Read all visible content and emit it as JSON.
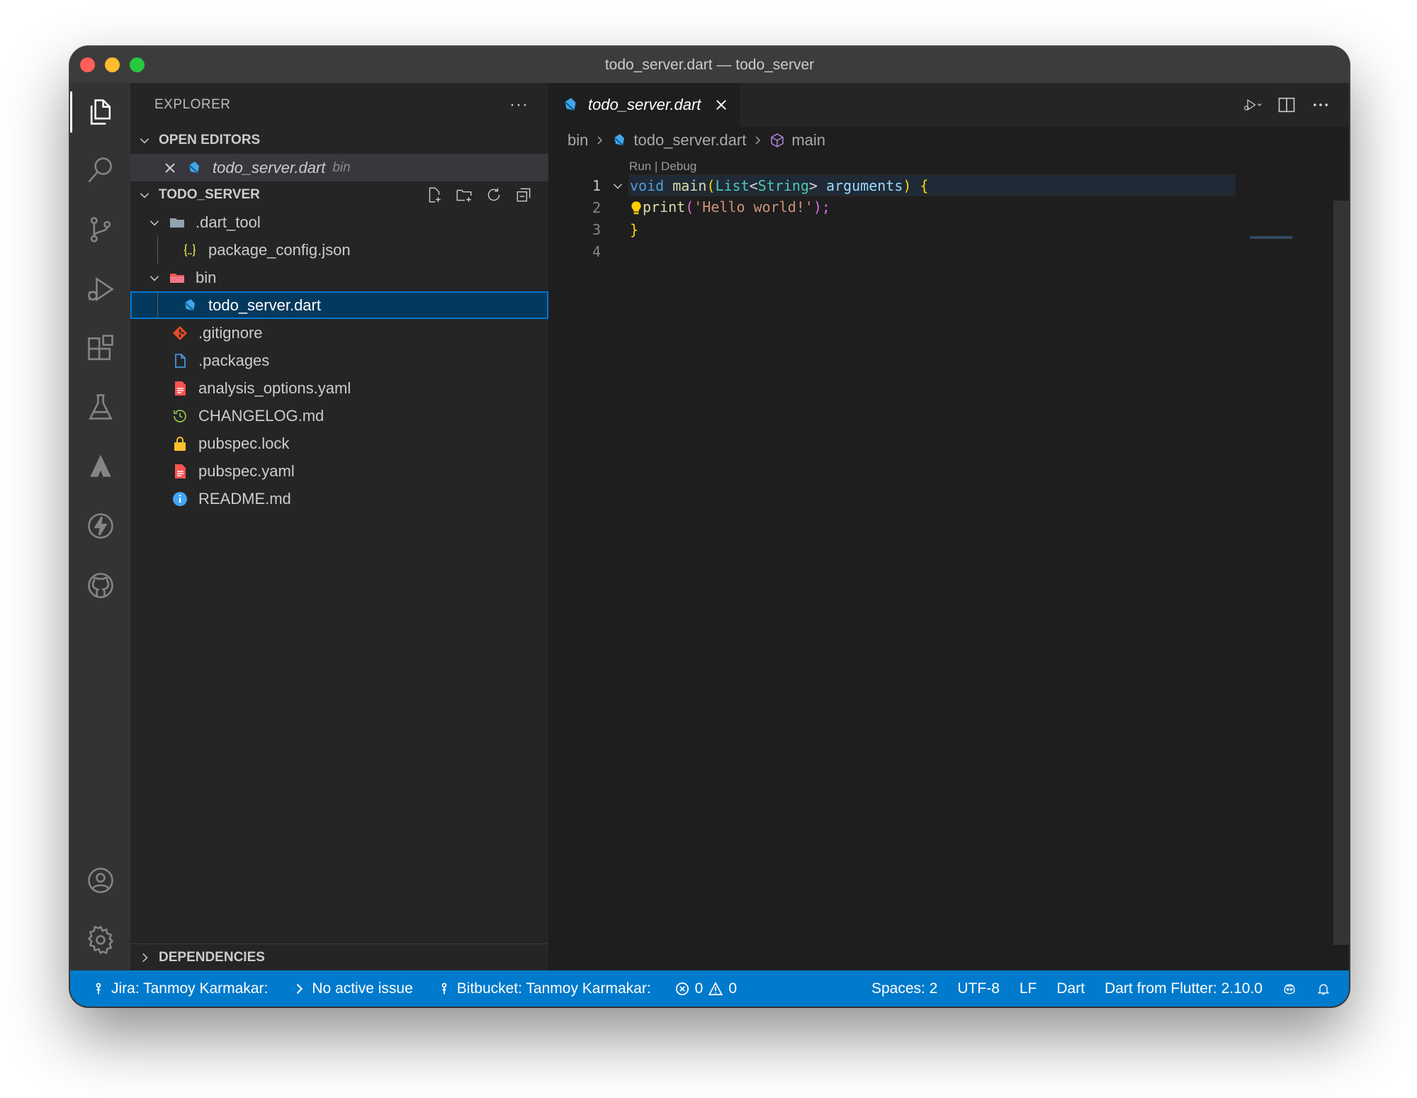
{
  "window": {
    "title": "todo_server.dart — todo_server"
  },
  "sidebar": {
    "title": "EXPLORER",
    "more": "···",
    "open_editors": {
      "label": "OPEN EDITORS",
      "items": [
        {
          "name": "todo_server.dart",
          "dir": "bin"
        }
      ]
    },
    "project": {
      "label": "TODO_SERVER",
      "tree": [
        {
          "label": ".dart_tool",
          "icon": "folder-icon"
        },
        {
          "label": "package_config.json",
          "icon": "json-icon"
        },
        {
          "label": "bin",
          "icon": "folder-bin-icon"
        },
        {
          "label": "todo_server.dart",
          "icon": "dart-icon"
        },
        {
          "label": ".gitignore",
          "icon": "git-icon"
        },
        {
          "label": ".packages",
          "icon": "file-icon"
        },
        {
          "label": "analysis_options.yaml",
          "icon": "yaml-icon"
        },
        {
          "label": "CHANGELOG.md",
          "icon": "changelog-icon"
        },
        {
          "label": "pubspec.lock",
          "icon": "lock-icon"
        },
        {
          "label": "pubspec.yaml",
          "icon": "yaml-icon"
        },
        {
          "label": "README.md",
          "icon": "info-icon"
        }
      ]
    },
    "dependencies_label": "DEPENDENCIES"
  },
  "editor": {
    "tab": {
      "label": "todo_server.dart"
    },
    "breadcrumb": {
      "folder": "bin",
      "file": "todo_server.dart",
      "symbol": "main"
    },
    "codelens": "Run | Debug",
    "line_numbers": [
      "1",
      "2",
      "3",
      "4"
    ],
    "code": {
      "l1_void": "void",
      "l1_main": "main",
      "l1_open_paren": "(",
      "l1_list": "List",
      "l1_lt": "<",
      "l1_string": "String",
      "l1_gt": ">",
      "l1_arguments": "arguments",
      "l1_close_paren": ")",
      "l1_brace": "{",
      "l2_print": "print",
      "l2_open": "(",
      "l2_string": "'Hello world!'",
      "l2_close": ");",
      "l3_brace": "}"
    }
  },
  "statusbar": {
    "jira": "Jira: Tanmoy Karmakar:",
    "issue": "No active issue",
    "bitbucket": "Bitbucket: Tanmoy Karmakar:",
    "errors": "0",
    "warnings": "0",
    "spaces": "Spaces: 2",
    "encoding": "UTF-8",
    "eol": "LF",
    "language": "Dart",
    "sdk": "Dart from Flutter: 2.10.0"
  },
  "colors": {
    "accent": "#007acc",
    "selection": "#04395e",
    "dart": "#41a7e8"
  }
}
